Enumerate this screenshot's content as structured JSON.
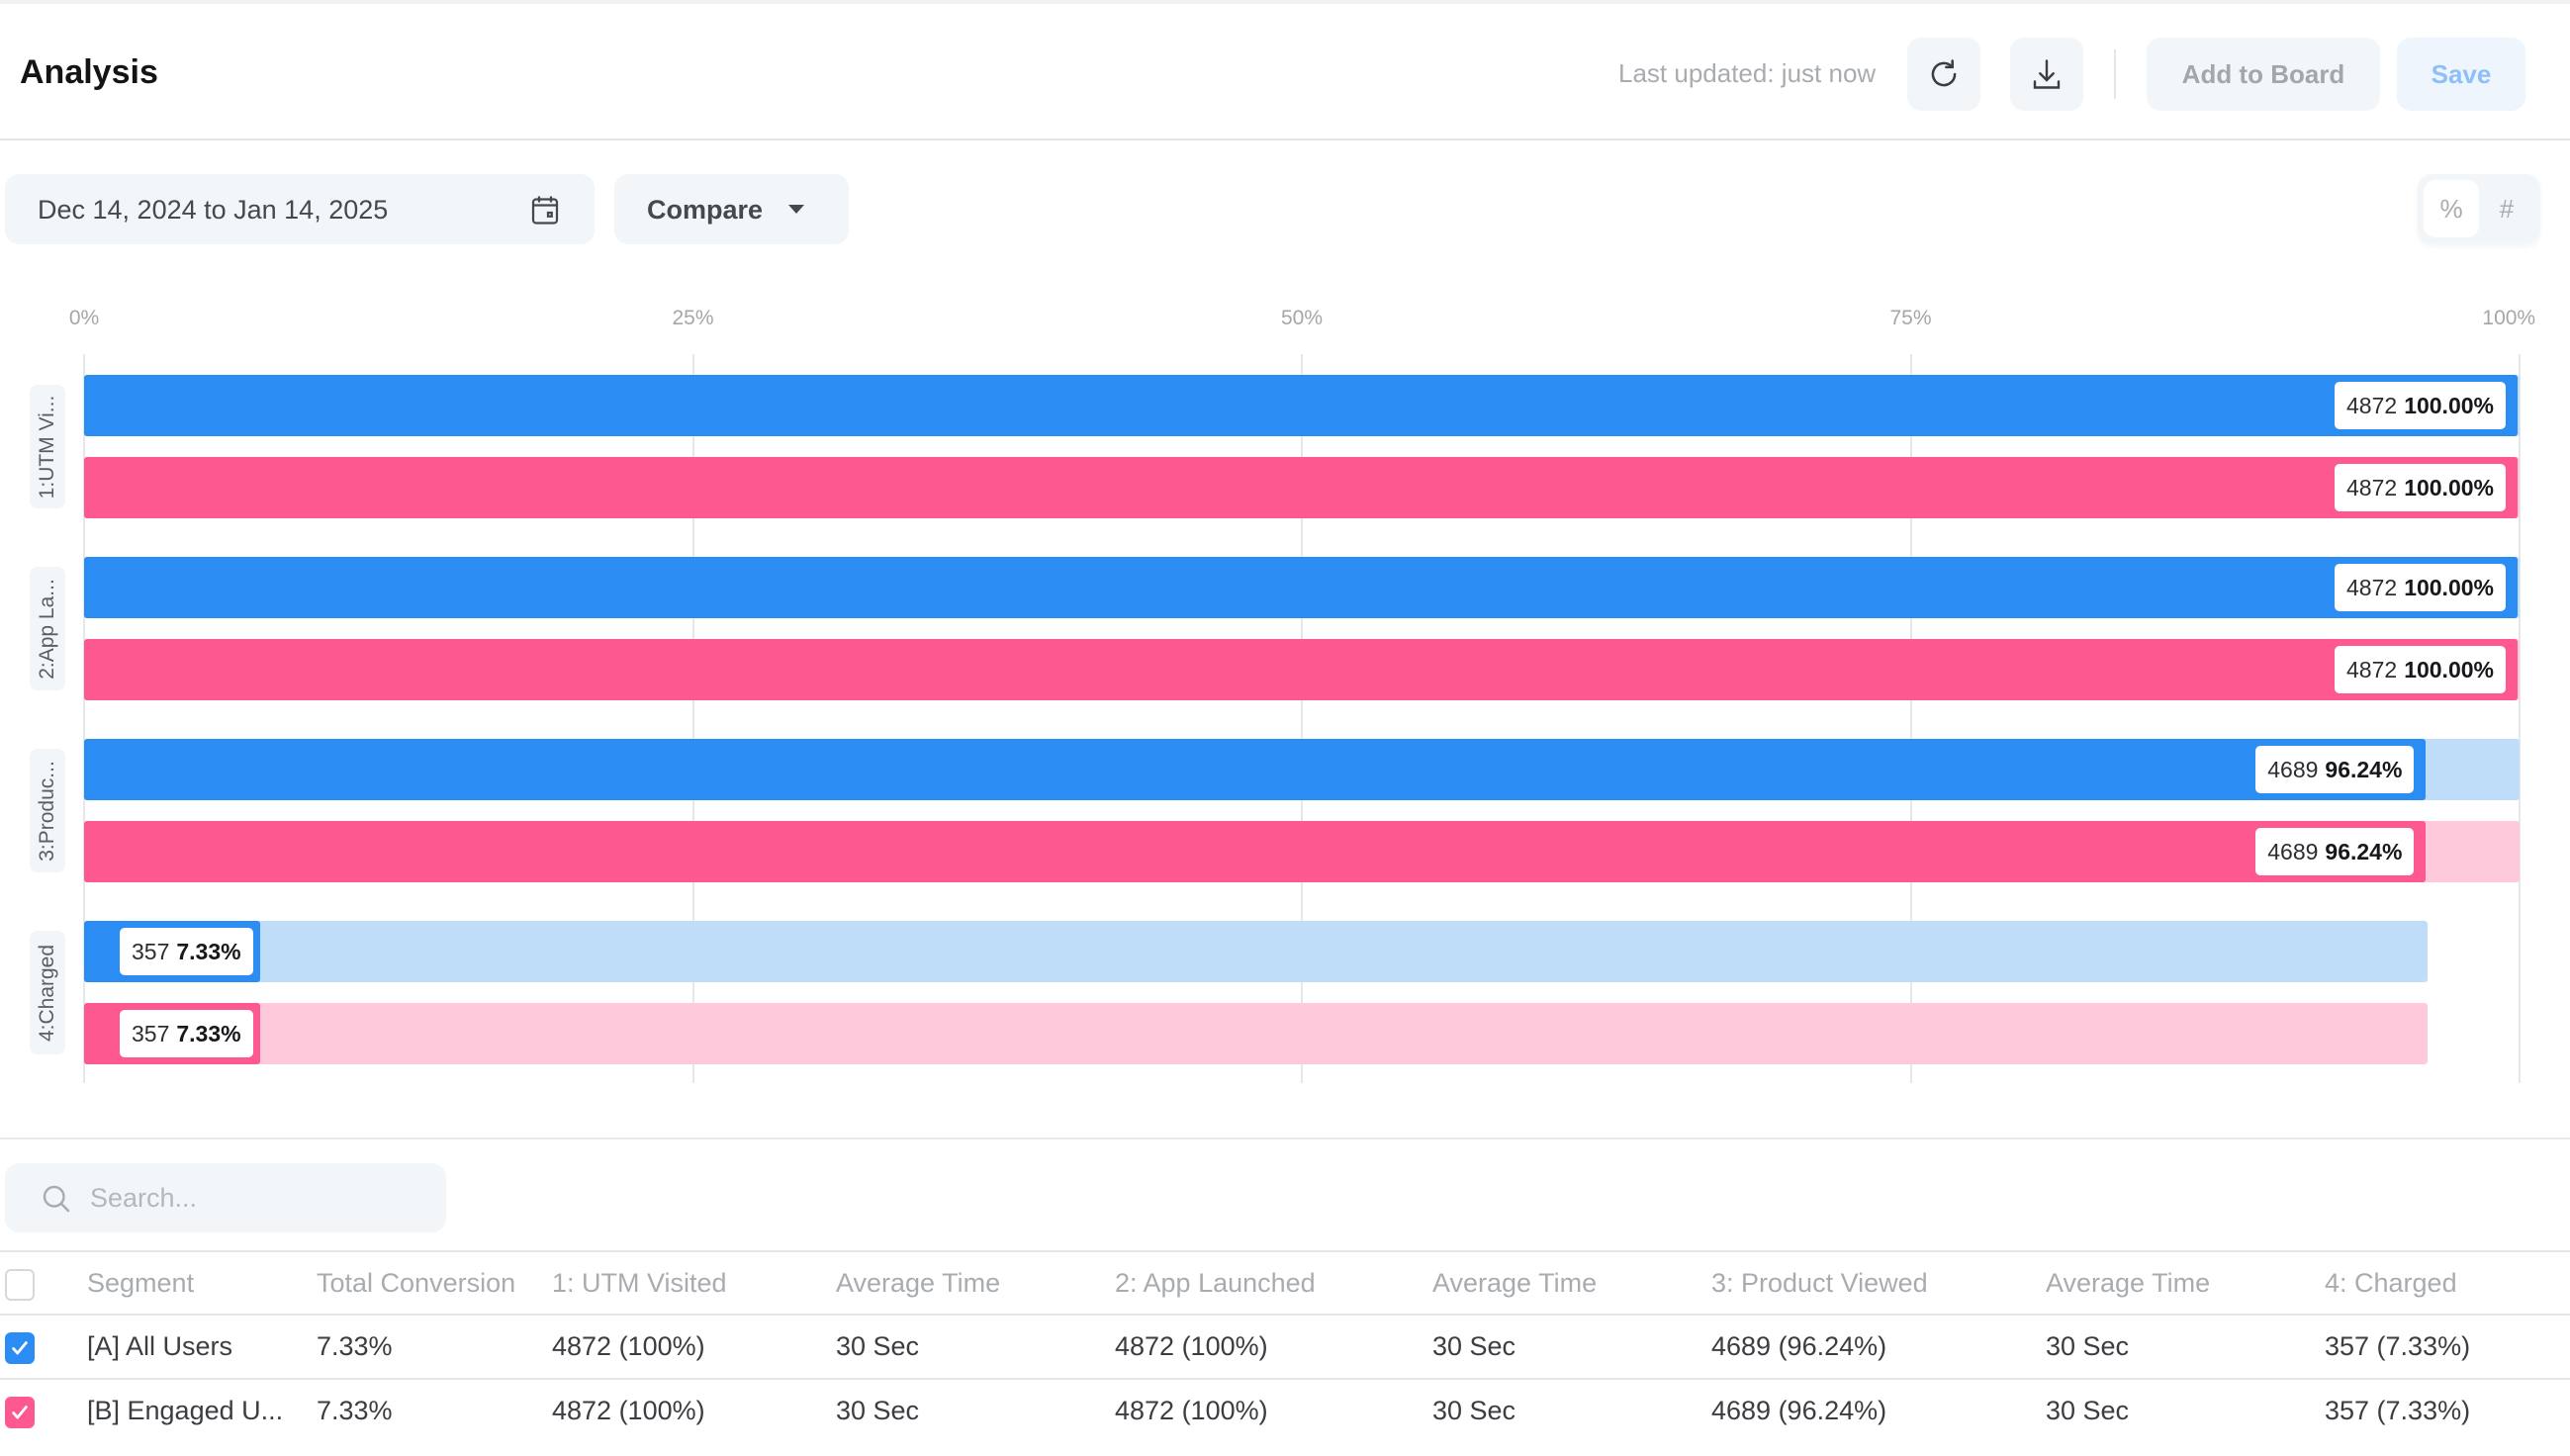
{
  "header": {
    "title": "Analysis",
    "last_updated": "Last updated: just now",
    "refresh_icon": "refresh-icon",
    "download_icon": "download-icon",
    "add_to_board_label": "Add to Board",
    "save_label": "Save"
  },
  "filters": {
    "date_range": "Dec 14, 2024 to Jan 14, 2025",
    "calendar_icon": "calendar-icon",
    "compare_label": "Compare",
    "toggle": {
      "percent_label": "%",
      "count_label": "#",
      "active": "percent"
    }
  },
  "colors": {
    "series_a": "#2b8cf4",
    "series_a_track": "#bfdcf9",
    "series_b": "#fd5890",
    "series_b_track": "#ffc9dc"
  },
  "chart_data": {
    "type": "bar",
    "orientation": "horizontal",
    "title": "",
    "xlabel": "",
    "ylabel": "",
    "xlim": [
      0,
      100
    ],
    "x_ticks": [
      "0%",
      "25%",
      "50%",
      "75%",
      "100%"
    ],
    "grid": true,
    "categories": [
      "1:UTM Vi...",
      "2:App La...",
      "3:Produc...",
      "4:Charged"
    ],
    "series": [
      {
        "name": "[A] All Users",
        "counts": [
          4872,
          4872,
          4689,
          357
        ],
        "values": [
          100.0,
          100.0,
          96.24,
          7.33
        ],
        "previous_step": [
          100.0,
          100.0,
          100.0,
          96.24
        ]
      },
      {
        "name": "[B] Engaged U...",
        "counts": [
          4872,
          4872,
          4689,
          357
        ],
        "values": [
          100.0,
          100.0,
          96.24,
          7.33
        ],
        "previous_step": [
          100.0,
          100.0,
          100.0,
          96.24
        ]
      }
    ],
    "value_labels": [
      [
        "4872",
        "100.00%"
      ],
      [
        "4872",
        "100.00%"
      ],
      [
        "4872",
        "100.00%"
      ],
      [
        "4872",
        "100.00%"
      ],
      [
        "4689",
        "96.24%"
      ],
      [
        "4689",
        "96.24%"
      ],
      [
        "357",
        "7.33%"
      ],
      [
        "357",
        "7.33%"
      ]
    ]
  },
  "search": {
    "placeholder": "Search...",
    "value": ""
  },
  "table": {
    "columns": [
      "Segment",
      "Total Conversion",
      "1: UTM Visited",
      "Average Time",
      "2: App Launched",
      "Average Time",
      "3: Product Viewed",
      "Average Time",
      "4: Charged"
    ],
    "rows": [
      {
        "checked": true,
        "color": "#2b8cf4",
        "cells": [
          "[A] All Users",
          "7.33%",
          "4872 (100%)",
          "30 Sec",
          "4872 (100%)",
          "30 Sec",
          "4689 (96.24%)",
          "30 Sec",
          "357 (7.33%)"
        ]
      },
      {
        "checked": true,
        "color": "#fd5890",
        "cells": [
          "[B] Engaged U...",
          "7.33%",
          "4872 (100%)",
          "30 Sec",
          "4872 (100%)",
          "30 Sec",
          "4689 (96.24%)",
          "30 Sec",
          "357 (7.33%)"
        ]
      }
    ]
  }
}
